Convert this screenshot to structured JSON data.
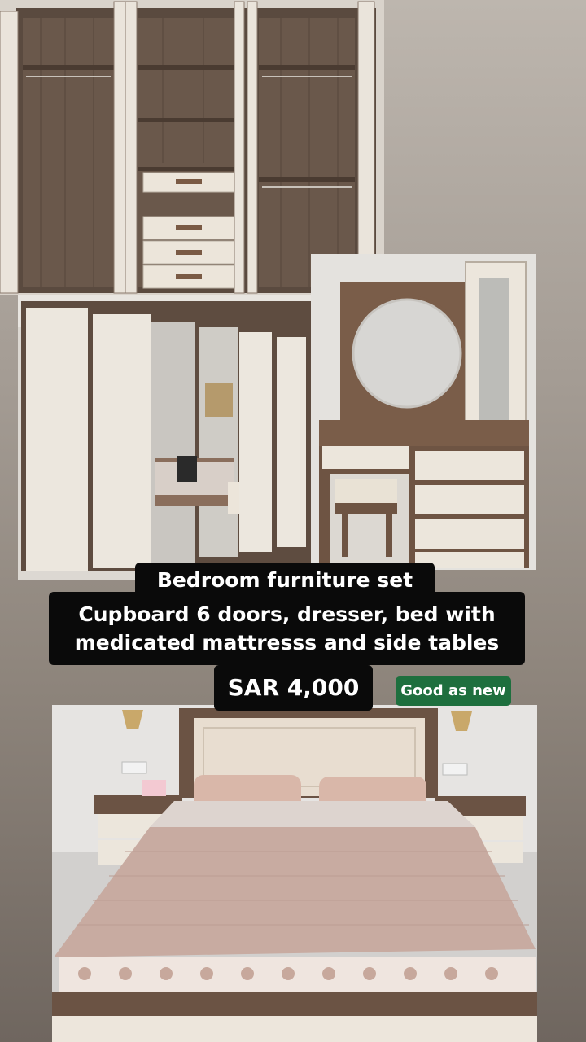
{
  "listing": {
    "title": "Bedroom furniture set",
    "description": "Cupboard 6 doors, dresser, bed with medicated mattresss and side tables",
    "description_line1": "Cupboard 6 doors, dresser, bed with",
    "description_line2": "medicated mattresss and side tables",
    "price": "SAR 4,000",
    "condition": "Good as new"
  },
  "photos": [
    {
      "name": "wardrobe-open-photo",
      "subject": "open six-door wardrobe with shelves and drawers"
    },
    {
      "name": "wardrobe-closed-photo",
      "subject": "closed wardrobe with mirrored doors"
    },
    {
      "name": "dresser-photo",
      "subject": "dresser with round mirror and stool"
    },
    {
      "name": "bed-photo",
      "subject": "bed with headboard, pillows and side tables"
    }
  ],
  "colors": {
    "caption_background": "#0a0a0a",
    "caption_text": "#ffffff",
    "condition_badge": "#1e6f3e",
    "wood": "#5a4a3f",
    "cream": "#ece5da"
  }
}
